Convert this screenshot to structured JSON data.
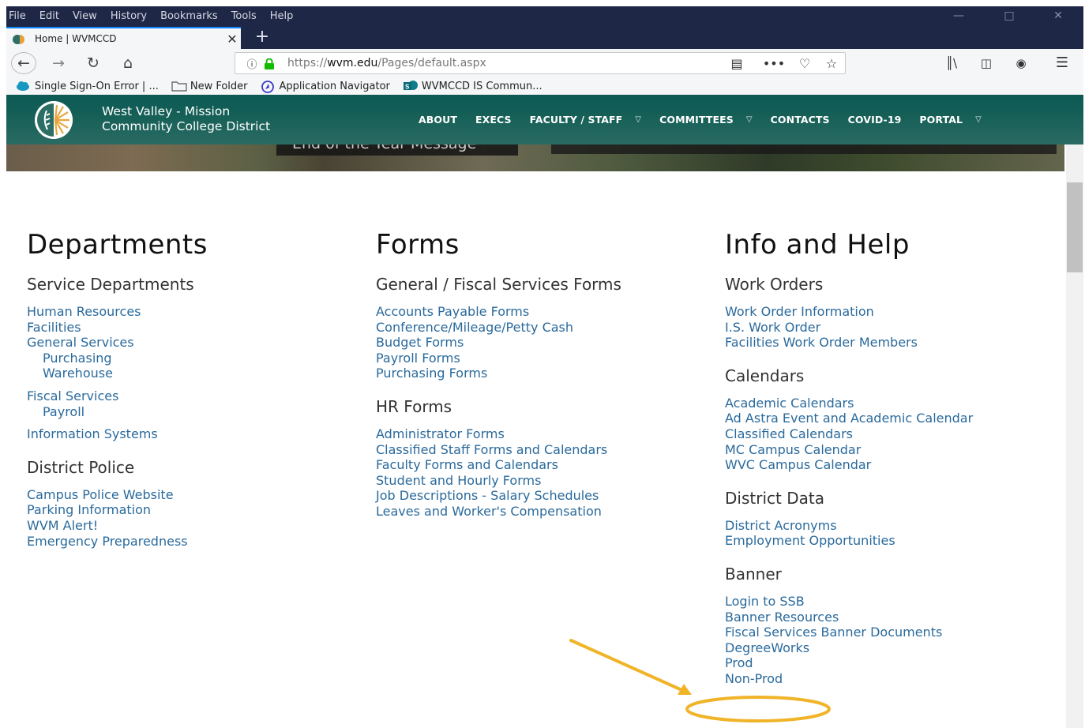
{
  "browser": {
    "menu": [
      "File",
      "Edit",
      "View",
      "History",
      "Bookmarks",
      "Tools",
      "Help"
    ],
    "tab_title": "Home | WVMCCD",
    "new_tab_label": "+",
    "url_scheme": "https://",
    "url_host": "wvm.edu",
    "url_path": "/Pages/default.aspx",
    "url_actions_more": "•••",
    "bookmarks": [
      "Single Sign-On Error | ...",
      "New Folder",
      "Application Navigator",
      "WVMCCD IS Commun..."
    ]
  },
  "site": {
    "name_line1": "West Valley - Mission",
    "name_line2": "Community College District",
    "nav": [
      {
        "label": "ABOUT",
        "dropdown": false
      },
      {
        "label": "EXECS",
        "dropdown": false
      },
      {
        "label": "FACULTY / STAFF",
        "dropdown": true
      },
      {
        "label": "COMMITTEES",
        "dropdown": true
      },
      {
        "label": "CONTACTS",
        "dropdown": false
      },
      {
        "label": "COVID-19",
        "dropdown": false
      },
      {
        "label": "PORTAL",
        "dropdown": true
      }
    ],
    "hero_text": "End of the Year Message"
  },
  "columns": [
    {
      "title": "Departments",
      "sections": [
        {
          "title": "Service Departments",
          "links": [
            {
              "label": "Human Resources"
            },
            {
              "label": "Facilities"
            },
            {
              "label": "General Services"
            },
            {
              "label": "Purchasing",
              "indent": true
            },
            {
              "label": "Warehouse",
              "indent": true
            },
            {
              "label": "Fiscal Services",
              "gap": true
            },
            {
              "label": "Payroll",
              "indent": true
            },
            {
              "label": "Information Systems",
              "gap": true
            }
          ]
        },
        {
          "title": "District Police",
          "links": [
            {
              "label": "Campus Police Website"
            },
            {
              "label": "Parking Information"
            },
            {
              "label": "WVM Alert!"
            },
            {
              "label": "Emergency Preparedness"
            }
          ]
        }
      ]
    },
    {
      "title": "Forms",
      "sections": [
        {
          "title": "General / Fiscal Services Forms",
          "links": [
            {
              "label": "Accounts Payable Forms"
            },
            {
              "label": "Conference/Mileage/Petty Cash"
            },
            {
              "label": "Budget Forms"
            },
            {
              "label": "Payroll Forms"
            },
            {
              "label": "Purchasing Forms"
            }
          ]
        },
        {
          "title": "HR Forms",
          "links": [
            {
              "label": "Administrator Forms"
            },
            {
              "label": "Classified Staff Forms and Calendars"
            },
            {
              "label": "Faculty Forms and Calendars"
            },
            {
              "label": "Student and Hourly Forms"
            },
            {
              "label": "Job Descriptions - Salary Schedules"
            },
            {
              "label": "Leaves and Worker's Compensation"
            }
          ]
        }
      ]
    },
    {
      "title": "Info and Help",
      "sections": [
        {
          "title": "Work Orders",
          "links": [
            {
              "label": "Work Order Information"
            },
            {
              "label": "I.S. Work Order"
            },
            {
              "label": "Facilities Work Order Members"
            }
          ]
        },
        {
          "title": "Calendars",
          "links": [
            {
              "label": "Academic Calendars"
            },
            {
              "label": "Ad Astra Event and Academic Calendar"
            },
            {
              "label": "Classified Calendars"
            },
            {
              "label": "MC Campus Calendar"
            },
            {
              "label": "WVC Campus Calendar"
            }
          ]
        },
        {
          "title": "District Data",
          "links": [
            {
              "label": "District Acronyms"
            },
            {
              "label": "Employment Opportunities"
            }
          ]
        },
        {
          "title": "Banner",
          "links": [
            {
              "label": "Login to SSB"
            },
            {
              "label": "Banner Resources"
            },
            {
              "label": "Fiscal Services Banner Documents"
            },
            {
              "label": "DegreeWorks"
            },
            {
              "label": "Prod"
            },
            {
              "label": "Non-Prod"
            }
          ]
        }
      ]
    }
  ],
  "colors": {
    "chrome_dark": "#1f2747",
    "header_teal": "#135e56",
    "link_blue": "#2a6a9c",
    "annotation_yellow": "#f0b429"
  }
}
